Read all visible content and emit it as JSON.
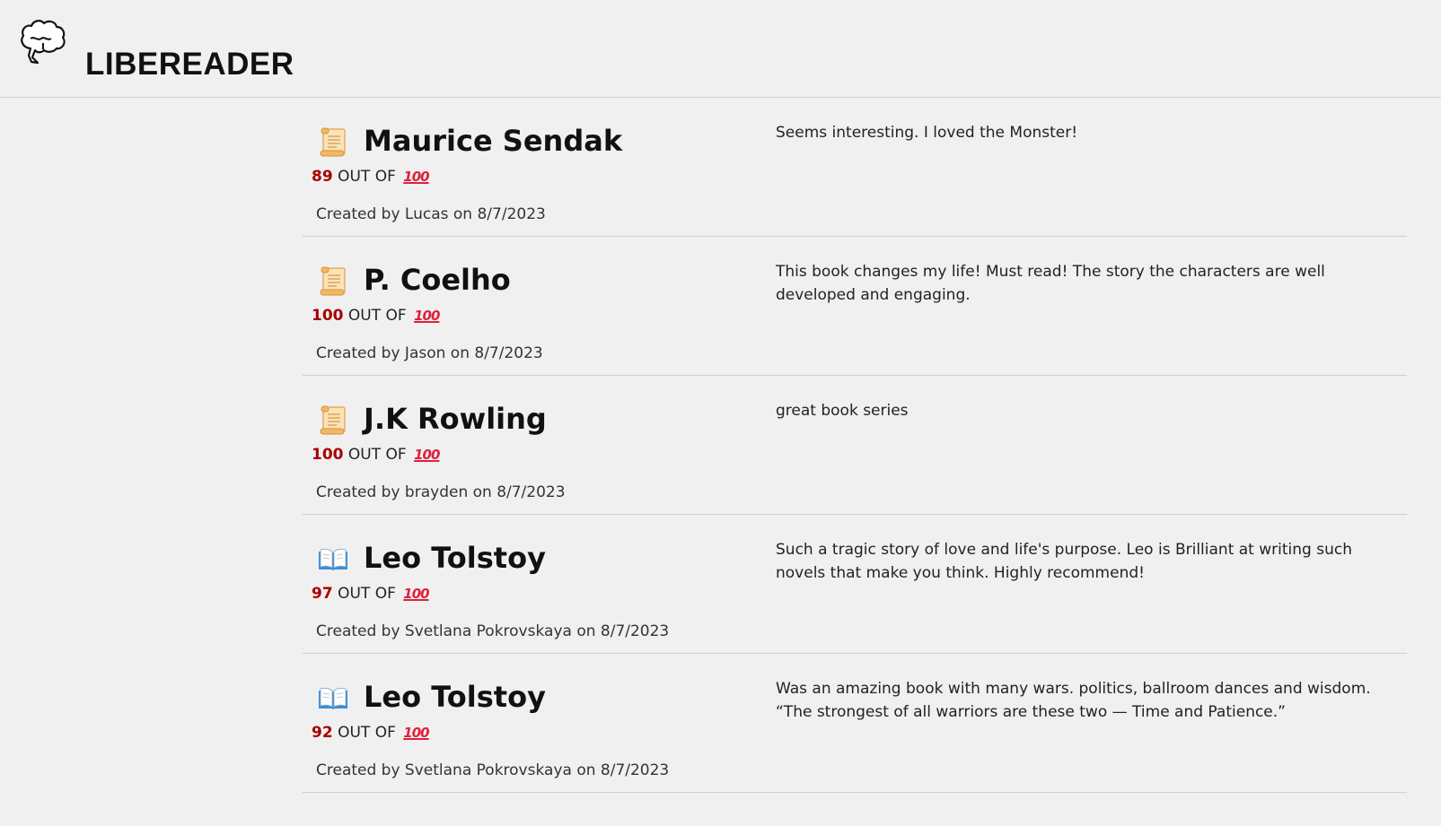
{
  "header": {
    "title": "LIBEREADER",
    "logo_icon": "brain-speech-bubble-icon"
  },
  "labels": {
    "out_of": "OUT OF",
    "hundred": "100",
    "created_prefix": "Created by",
    "created_on": "on"
  },
  "colors": {
    "background": "#f0f0f0",
    "score": "#a80000",
    "hundred_emoji": "#e0203a",
    "divider": "#cfcfcf"
  },
  "reviews": [
    {
      "icon": "scroll-icon",
      "author": "Maurice Sendak",
      "score": "89",
      "created_text": "Created by Lucas on 8/7/2023",
      "comment": "Seems interesting. I loved the Monster!"
    },
    {
      "icon": "scroll-icon",
      "author": "P. Coelho",
      "score": "100",
      "created_text": "Created by Jason on 8/7/2023",
      "comment": "This book changes my life! Must read! The story the characters are well developed and engaging."
    },
    {
      "icon": "scroll-icon",
      "author": "J.K Rowling",
      "score": "100",
      "created_text": "Created by brayden on 8/7/2023",
      "comment": "great book series"
    },
    {
      "icon": "open-book-icon",
      "author": "Leo Tolstoy",
      "score": "97",
      "created_text": "Created by Svetlana Pokrovskaya on 8/7/2023",
      "comment": "Such a tragic story of love and life's purpose. Leo is Brilliant at writing such novels that make you think. Highly recommend!"
    },
    {
      "icon": "open-book-icon",
      "author": "Leo Tolstoy",
      "score": "92",
      "created_text": "Created by Svetlana Pokrovskaya on 8/7/2023",
      "comment": "Was an amazing book with many wars. politics, ballroom dances and wisdom. “The strongest of all warriors are these two — Time and Patience.”"
    }
  ]
}
